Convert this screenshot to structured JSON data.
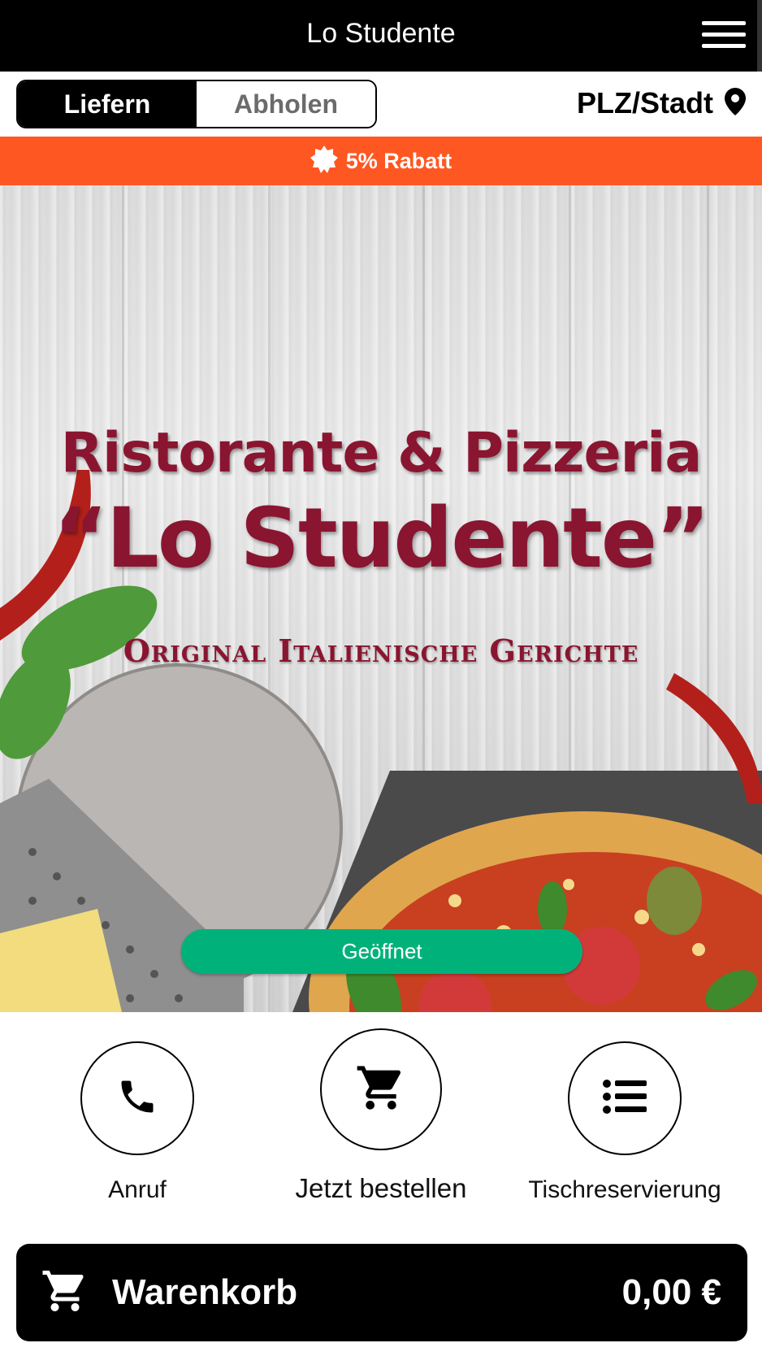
{
  "app": {
    "title": "Lo Studente"
  },
  "mode": {
    "deliver_label": "Liefern",
    "pickup_label": "Abholen",
    "active": "Liefern"
  },
  "location": {
    "label": "PLZ/Stadt"
  },
  "discount": {
    "label": "5% Rabatt"
  },
  "hero": {
    "line1": "Ristorante & Pizzeria",
    "line2": "“Lo Studente”",
    "line3": "Original Italienische Gerichte",
    "status": "Geöffnet"
  },
  "actions": [
    {
      "label": "Anruf",
      "icon": "phone-icon"
    },
    {
      "label": "Jetzt bestellen",
      "icon": "cart-icon"
    },
    {
      "label": "Tischreservierung",
      "icon": "list-icon"
    }
  ],
  "cart": {
    "label": "Warenkorb",
    "total": "0,00 €"
  },
  "colors": {
    "accent": "#ff5722",
    "open": "#00b27a",
    "brand_red": "#8a1530",
    "bar": "#000000"
  }
}
